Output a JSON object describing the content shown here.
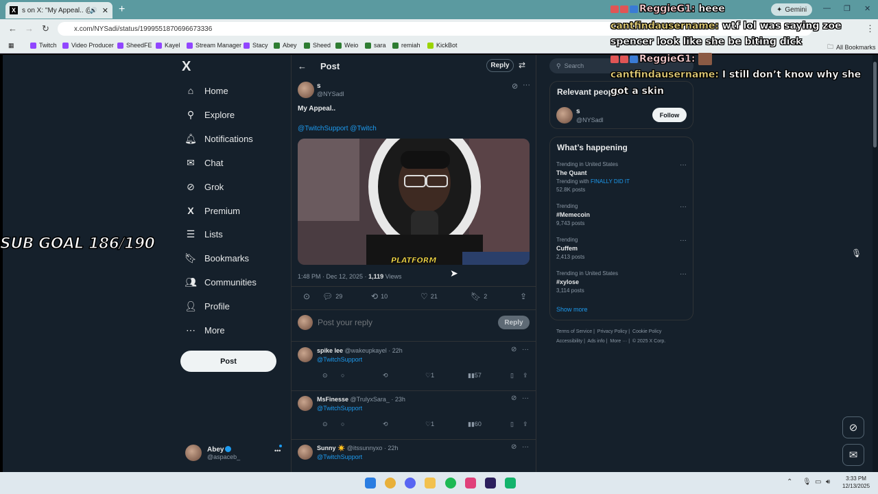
{
  "browser": {
    "tab_title": "s on X: \"My Appeal.. @Twi...",
    "tab_favicon": "X",
    "new_tab": "+",
    "gemini_label": "Gemini",
    "url": "x.com/NYSadi/status/1999551870696673336",
    "bookmarks": [
      "Twitch",
      "Video Producer",
      "SheedFE",
      "Kayel",
      "Stream Manager",
      "Stacy",
      "Abey",
      "Sheed",
      "Weio",
      "sara",
      "remiah",
      "KickBot"
    ],
    "all_bookmarks": "All Bookmarks"
  },
  "nav": {
    "logo": "X",
    "items": [
      "Home",
      "Explore",
      "Notifications",
      "Chat",
      "Grok",
      "Premium",
      "Lists",
      "Bookmarks",
      "Communities",
      "Profile",
      "More"
    ],
    "post_button": "Post",
    "account": {
      "name": "Abey",
      "handle": "@aspaceb_",
      "more": "•••"
    }
  },
  "overlay": {
    "sub_goal": "SUB GOAL 186/190",
    "chat": [
      {
        "user": "ReggieG1:",
        "message": "heee"
      },
      {
        "user": "cantfindausername:",
        "message": "wtf lol was saying zoe"
      },
      {
        "user": "",
        "message": "spencer look like she be biting dick"
      },
      {
        "user": "ReggieG1:",
        "message": ""
      },
      {
        "user": "cantfindausername:",
        "message": "I still don’t know why she"
      },
      {
        "user": "",
        "message": "got a skin"
      }
    ]
  },
  "post": {
    "header_title": "Post",
    "header_reply": "Reply",
    "author": "s",
    "handle": "@NYSadl",
    "text": "My Appeal..",
    "mentions": "@TwitchSupport @Twitch",
    "media_caption": "PLATFORM",
    "time": "1:48 PM · Dec 12, 2025 ·",
    "views_count": "1,119",
    "views_label": "Views",
    "replies": "29",
    "reposts": "10",
    "likes": "21",
    "bookmarks": "2",
    "reply_placeholder": "Post your reply",
    "reply_button": "Reply"
  },
  "replies": [
    {
      "name": "spike lee",
      "handle": "@wakeupkayel · 22h",
      "mention": "@TwitchSupport",
      "likes": "1",
      "views": "57"
    },
    {
      "name": "MsFinesse",
      "handle": "@TrulyxSara_ · 23h",
      "mention": "@TwitchSupport",
      "likes": "1",
      "views": "60"
    },
    {
      "name": "Sunny ☀️",
      "handle": "@itssunnyxo · 22h",
      "mention": "@TwitchSupport"
    }
  ],
  "sidebar": {
    "search_placeholder": "Search",
    "relevant_title": "Relevant people",
    "relevant_person": {
      "name": "s",
      "handle": "@NYSadl",
      "button": "Follow"
    },
    "happening_title": "What’s happening",
    "trends": [
      {
        "category": "Trending in United States",
        "name": "The Quant",
        "sub_prefix": "Trending with",
        "sub_link": "FINALLY DID IT",
        "count": "52.8K posts"
      },
      {
        "category": "Trending",
        "name": "#Memecoin",
        "count": "9,743 posts"
      },
      {
        "category": "Trending",
        "name": "Cuffem",
        "count": "2,413 posts"
      },
      {
        "category": "Trending in United States",
        "name": "#xylose",
        "count": "3,114 posts"
      }
    ],
    "show_more": "Show more",
    "footer_line1": [
      "Terms of Service",
      "Privacy Policy",
      "Cookie Policy"
    ],
    "footer_line2": [
      "Accessibility",
      "Ads info",
      "More ···",
      "© 2025 X Corp."
    ]
  },
  "taskbar": {
    "time": "3:33 PM",
    "date": "12/13/2025"
  },
  "colors": {
    "page_bg": "#15202b",
    "accent": "#1d9bf0",
    "tab_bar": "#5b9aa0"
  }
}
